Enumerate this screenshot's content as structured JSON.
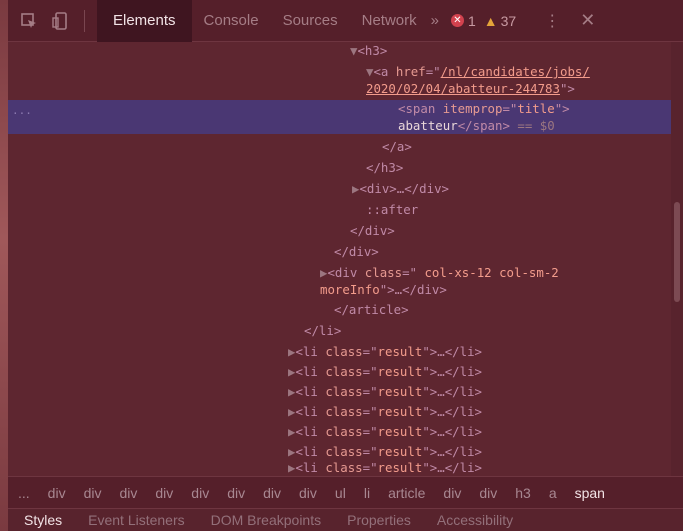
{
  "toolbar": {
    "icons": [
      "inspect-element-icon",
      "device-toggle-icon"
    ],
    "tabs": [
      "Elements",
      "Console",
      "Sources",
      "Network"
    ],
    "overflow_label": "»",
    "error_count": "1",
    "warning_count": "37",
    "kebab_label": "⋮",
    "close_label": "✕"
  },
  "dom": {
    "h3_open": "<h3>",
    "a_open_prefix": "<a ",
    "href_attr": "href",
    "href_value_1": "/nl/candidates/jobs/",
    "href_value_2": "2020/02/04/abatteur-244783",
    "a_open_suffix": "\">",
    "span_open_prefix": "<span ",
    "itemprop_attr": "itemprop",
    "itemprop_value": "title",
    "span_text": "abatteur",
    "span_close": "</span>",
    "selected_marker": " == $0",
    "a_close": "</a>",
    "h3_close": "</h3>",
    "div_collapsed": "<div>…</div>",
    "after_pseudo": "::after",
    "div_close": "</div>",
    "moreinfo_prefix": "<div ",
    "class_attr": "class",
    "moreinfo_value_1": " col-xs-12 col-sm-2",
    "moreinfo_value_2": "moreInfo",
    "moreinfo_suffix": ">…</div>",
    "article_close": "</article>",
    "li_close": "</li>",
    "li_prefix": "<li ",
    "li_class_value": "result",
    "li_suffix": ">…</li>",
    "more_dots": "..."
  },
  "breadcrumbs": [
    "...",
    "div",
    "div",
    "div",
    "div",
    "div",
    "div",
    "div",
    "div",
    "ul",
    "li",
    "article",
    "div",
    "div",
    "h3",
    "a",
    "span"
  ],
  "subtabs": [
    "Styles",
    "Event Listeners",
    "DOM Breakpoints",
    "Properties",
    "Accessibility"
  ]
}
